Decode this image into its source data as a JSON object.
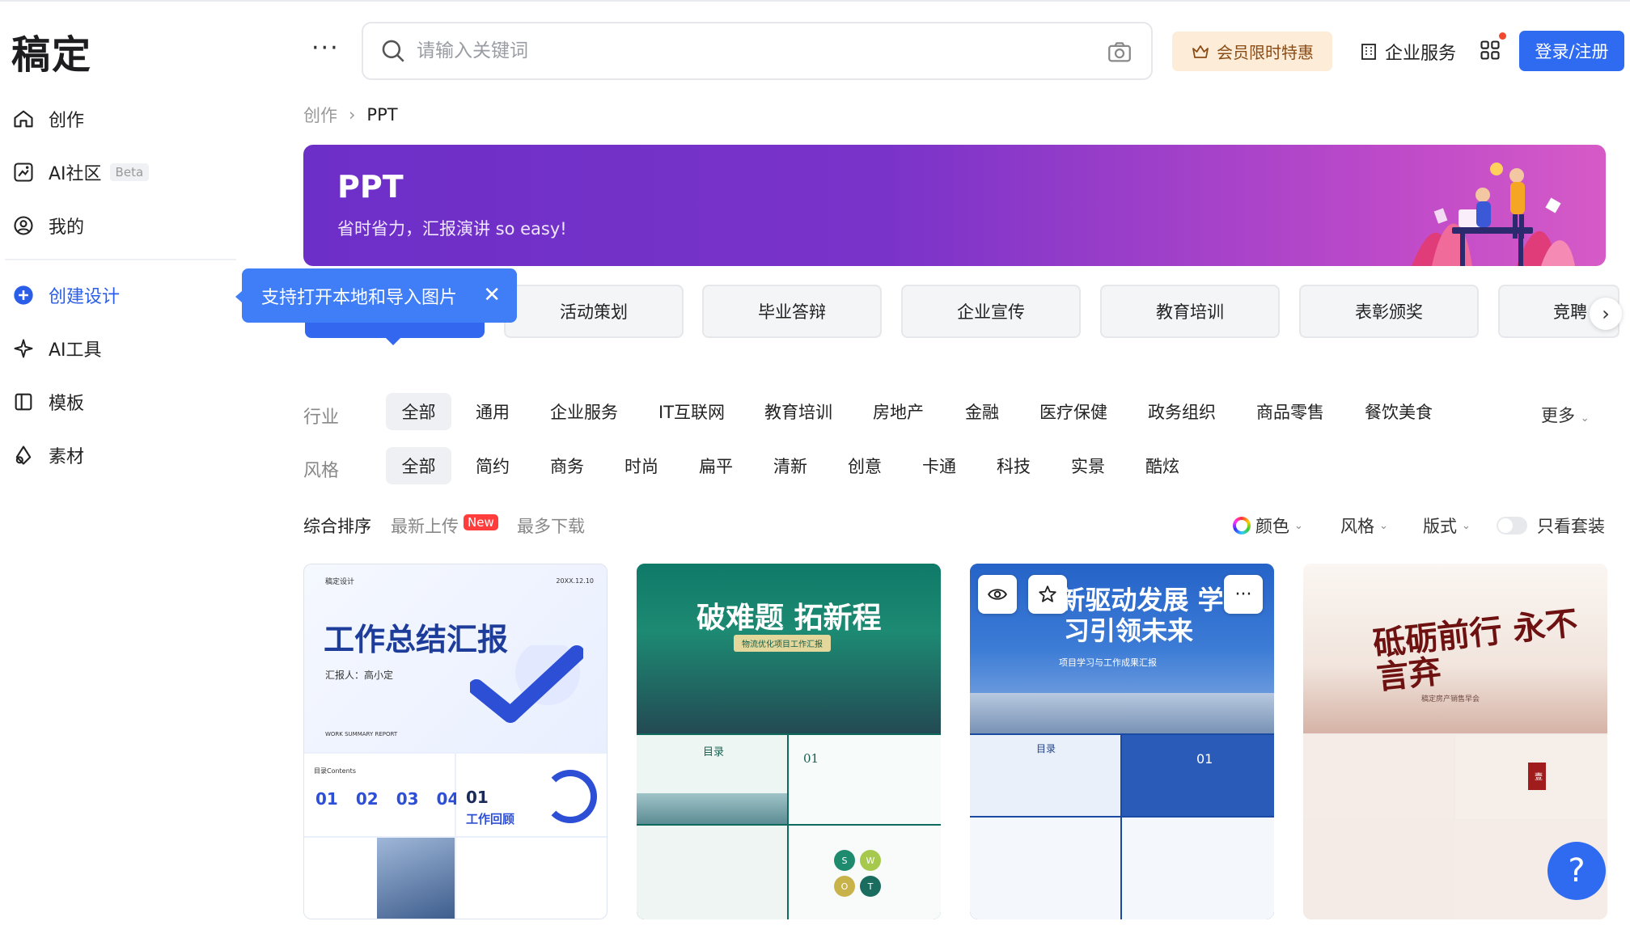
{
  "app": {
    "logo": "稿定"
  },
  "sidebar": {
    "items": [
      {
        "label": "创作",
        "icon": "home-icon"
      },
      {
        "label": "AI社区",
        "badge": "Beta",
        "icon": "ai-community-icon"
      },
      {
        "label": "我的",
        "icon": "user-icon"
      },
      {
        "label": "创建设计",
        "icon": "plus-circle-icon"
      },
      {
        "label": "AI工具",
        "icon": "sparkle-icon"
      },
      {
        "label": "模板",
        "icon": "template-icon"
      },
      {
        "label": "素材",
        "icon": "material-icon"
      }
    ]
  },
  "tooltip": {
    "text": "支持打开本地和导入图片",
    "close": "✕"
  },
  "header": {
    "more": "···",
    "search_placeholder": "请输入关键词",
    "vip_label": "会员限时特惠",
    "enterprise_label": "企业服务",
    "login_label": "登录/注册"
  },
  "breadcrumb": {
    "parent": "创作",
    "separator": "›",
    "current": "PPT"
  },
  "banner": {
    "title": "PPT",
    "subtitle": "省时省力，汇报演讲 so easy!"
  },
  "categories": [
    "活动策划",
    "毕业答辩",
    "企业宣传",
    "教育培训",
    "表彰颁奖",
    "竞聘"
  ],
  "filters": {
    "industry_label": "行业",
    "industry": [
      "全部",
      "通用",
      "企业服务",
      "IT互联网",
      "教育培训",
      "房地产",
      "金融",
      "医疗保健",
      "政务组织",
      "商品零售",
      "餐饮美食"
    ],
    "more_label": "更多",
    "style_label": "风格",
    "style": [
      "全部",
      "简约",
      "商务",
      "时尚",
      "扁平",
      "清新",
      "创意",
      "卡通",
      "科技",
      "实景",
      "酷炫"
    ]
  },
  "sort": {
    "options": [
      "综合排序",
      "最新上传",
      "最多下载"
    ],
    "new_badge": "New",
    "right_filters": {
      "color": "颜色",
      "style": "风格",
      "layout": "版式",
      "set_only": "只看套装"
    }
  },
  "cards": [
    {
      "brand": "稿定设计",
      "year": "20XX.12.10",
      "title": "工作总结汇报",
      "reporter": "汇报人：高小定",
      "caption": "WORK SUMMARY REPORT",
      "contents": "目录Contents",
      "nums": [
        "01",
        "02",
        "03",
        "04"
      ],
      "section_no": "01",
      "section_title": "工作回顾"
    },
    {
      "title": "破难题 拓新程",
      "subtitle": "物流优化项目工作汇报",
      "contents": "目录",
      "swot": [
        "S",
        "W",
        "O",
        "T"
      ],
      "section_no": "01"
    },
    {
      "title": "创新驱动发展 学习引领未来",
      "subtitle": "项目学习与工作成果汇报",
      "contents": "目录",
      "section_no": "01"
    },
    {
      "title": "砥砺前行 永不言弃",
      "subtitle": "稿定房产销售早会",
      "seal": "壹"
    }
  ],
  "help": "?"
}
